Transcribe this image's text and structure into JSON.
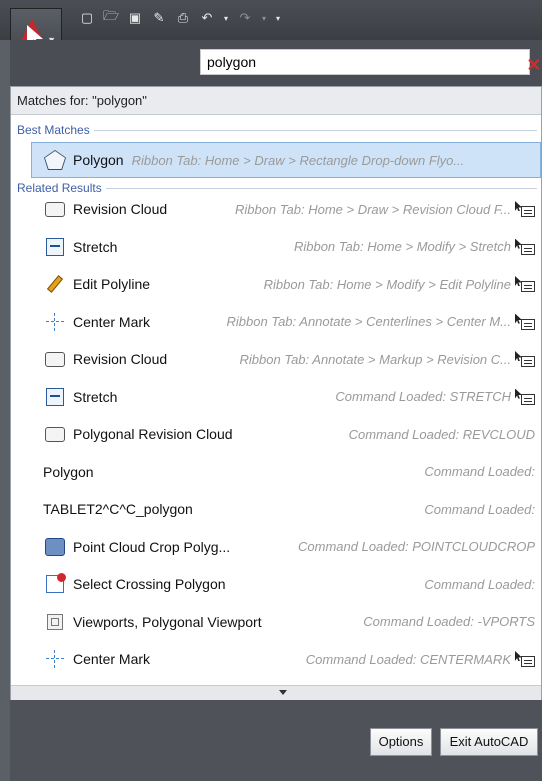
{
  "toolbar": {
    "icons": [
      "new-icon",
      "open-icon",
      "save-icon",
      "save-as-icon",
      "print-icon",
      "undo-icon",
      "redo-icon",
      "customize-icon"
    ]
  },
  "search": {
    "value": "polygon",
    "clear_icon": "✕"
  },
  "results": {
    "header": "Matches for: \"polygon\"",
    "best_matches_label": "Best Matches",
    "related_results_label": "Related Results",
    "best": {
      "name": "Polygon",
      "desc": "Ribbon Tab: Home > Draw > Rectangle Drop-down Flyo..."
    },
    "items": [
      {
        "name": "Revision Cloud",
        "desc": "Ribbon Tab: Home > Draw > Revision Cloud F...",
        "icon": "revision-cloud-icon",
        "locate": true
      },
      {
        "name": "Stretch",
        "desc": "Ribbon Tab: Home > Modify > Stretch",
        "icon": "stretch-icon",
        "locate": true
      },
      {
        "name": "Edit Polyline",
        "desc": "Ribbon Tab: Home > Modify > Edit Polyline",
        "icon": "edit-polyline-icon",
        "locate": true
      },
      {
        "name": "Center Mark",
        "desc": "Ribbon Tab: Annotate > Centerlines > Center M...",
        "icon": "center-mark-icon",
        "locate": true
      },
      {
        "name": "Revision Cloud",
        "desc": "Ribbon Tab: Annotate > Markup > Revision C...",
        "icon": "revision-cloud-icon",
        "locate": true
      },
      {
        "name": "Stretch",
        "desc": "Command Loaded: STRETCH",
        "icon": "stretch-icon",
        "locate": true
      },
      {
        "name": "Polygonal Revision Cloud",
        "desc": "Command Loaded: REVCLOUD",
        "icon": "revision-cloud-icon",
        "locate": false
      },
      {
        "name": "Polygon",
        "desc": "Command Loaded:",
        "icon": "",
        "locate": false
      },
      {
        "name": "TABLET2^C^C_polygon",
        "desc": "Command Loaded:",
        "icon": "",
        "locate": false
      },
      {
        "name": "Point Cloud Crop Polyg...",
        "desc": "Command Loaded: POINTCLOUDCROP",
        "icon": "point-cloud-crop-icon",
        "locate": false
      },
      {
        "name": "Select Crossing Polygon",
        "desc": "Command Loaded:",
        "icon": "select-crossing-icon",
        "locate": false
      },
      {
        "name": "Viewports, Polygonal Viewport",
        "desc": "Command Loaded: -VPORTS",
        "icon": "viewports-icon",
        "locate": false
      },
      {
        "name": "Center Mark",
        "desc": "Command Loaded: CENTERMARK",
        "icon": "center-mark-icon",
        "locate": true
      }
    ]
  },
  "buttons": {
    "options": "Options",
    "exit": "Exit AutoCAD"
  }
}
